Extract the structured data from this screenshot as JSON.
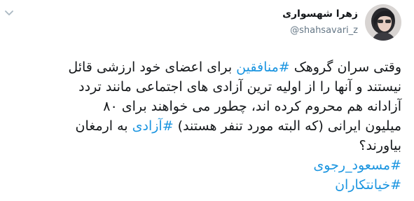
{
  "author": {
    "display_name": "زهرا شهسواری",
    "handle": "@shahsavari_z",
    "avatar_icon": "profile-photo"
  },
  "menu": {
    "icon": "chevron-down-icon"
  },
  "tweet": {
    "lines": [
      {
        "pre": "وقتی سران گروهک ",
        "tag": "#منافقین",
        "post": " برای اعضای خود ارزشی قائل"
      },
      {
        "text": "نیستند و آنها را از اولیه ترین آزادی های اجتماعی مانند تردد"
      },
      {
        "text": "آزادانه هم محروم کرده اند، چطور می خواهند برای ۸۰"
      },
      {
        "pre": "میلیون ایرانی (که البته مورد تنفر هستند) ",
        "tag": "#آزادی",
        "post": " به ارمغان"
      },
      {
        "text": "بیاورند؟"
      }
    ],
    "hashtags": [
      "#مسعود_رجوی",
      "#خیانتکاران"
    ]
  },
  "colors": {
    "link": "#1b95e0",
    "text": "#14171a",
    "muted": "#657786"
  }
}
